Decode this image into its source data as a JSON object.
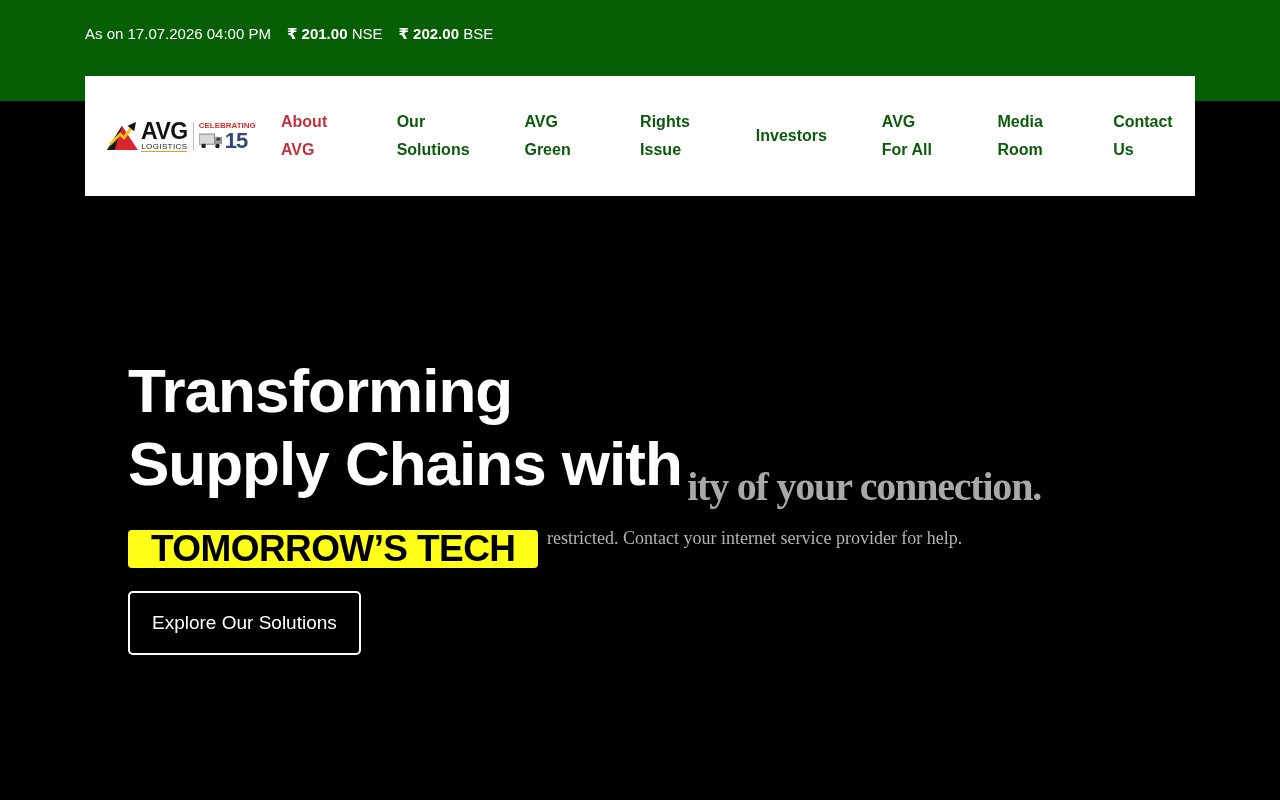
{
  "ticker": {
    "as_on": "As on 17.07.2026 04:00 PM",
    "quotes": [
      "**₹ 201.00** NSE",
      "**₹ 202.00** BSE"
    ]
  },
  "logo": {
    "wordmark": "AVG",
    "tagline": "LOGISTICS",
    "badge_number": "15",
    "badge_caption": "CELEBRATING"
  },
  "nav": [
    {
      "label": "About AVG",
      "selected": true
    },
    {
      "label": "Our Solutions",
      "selected": false
    },
    {
      "label": "AVG Green",
      "selected": false
    },
    {
      "label": "Rights Issue",
      "selected": false
    },
    {
      "label": "Investors",
      "selected": false
    },
    {
      "label": "AVG For All",
      "selected": false
    },
    {
      "label": "Media Room",
      "selected": false
    },
    {
      "label": "Contact Us",
      "selected": false
    }
  ],
  "hero": {
    "title": "Transforming Supply Chains with",
    "highlight": "TOMORROW’S TECH",
    "button": "Explore Our Solutions"
  },
  "connection_error": {
    "heading": "ity of your connection.",
    "message": "restricted. Contact your internet service provider for help."
  }
}
